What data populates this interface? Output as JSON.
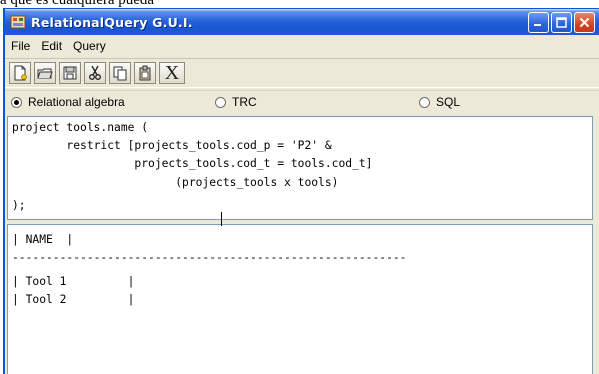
{
  "page_fragment": "a que es cualquiera pueda",
  "window": {
    "title": "RelationalQuery G.U.I.",
    "icons": {
      "app": "app-icon",
      "minimize": "minimize-icon",
      "maximize": "maximize-icon",
      "close": "close-icon"
    }
  },
  "menu": {
    "items": [
      "File",
      "Edit",
      "Query"
    ]
  },
  "toolbar": {
    "tools": [
      "new-query-icon",
      "open-icon",
      "save-icon",
      "cut-icon",
      "copy-icon",
      "paste-icon",
      "clear-x-icon"
    ],
    "clear_label": "X"
  },
  "query_mode": {
    "options": [
      "Relational algebra",
      "TRC",
      "SQL"
    ],
    "selected": "Relational algebra"
  },
  "editor": {
    "lines": [
      "project tools.name (",
      "        restrict [projects_tools.cod_p = 'P2' &",
      "                  projects_tools.cod_t = tools.cod_t]",
      "                        (projects_tools x tools)",
      ");"
    ]
  },
  "results": {
    "lines": [
      "| NAME  |",
      "----------------------------------------------------------",
      "| Tool 1         |",
      "| Tool 2         |"
    ]
  }
}
